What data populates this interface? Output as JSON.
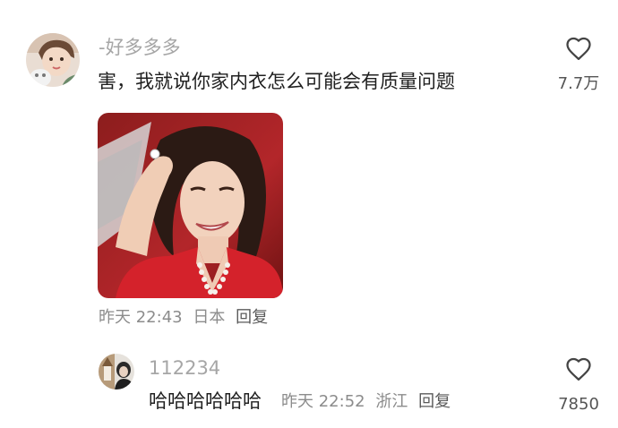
{
  "comments": [
    {
      "username": "-好多多多",
      "text": "害，我就说你家内衣怎么可能会有质量问题",
      "time": "昨天 22:43",
      "location": "日本",
      "reply_label": "回复",
      "like_count": "7.7万"
    },
    {
      "username": "112234",
      "text": "哈哈哈哈哈哈",
      "time": "昨天 22:52",
      "location": "浙江",
      "reply_label": "回复",
      "like_count": "7850"
    }
  ],
  "icons": {
    "like": "heart-outline-icon"
  },
  "colors": {
    "username": "#a6a6a6",
    "meta": "#8c8c8c",
    "text": "#1f1f1f"
  }
}
